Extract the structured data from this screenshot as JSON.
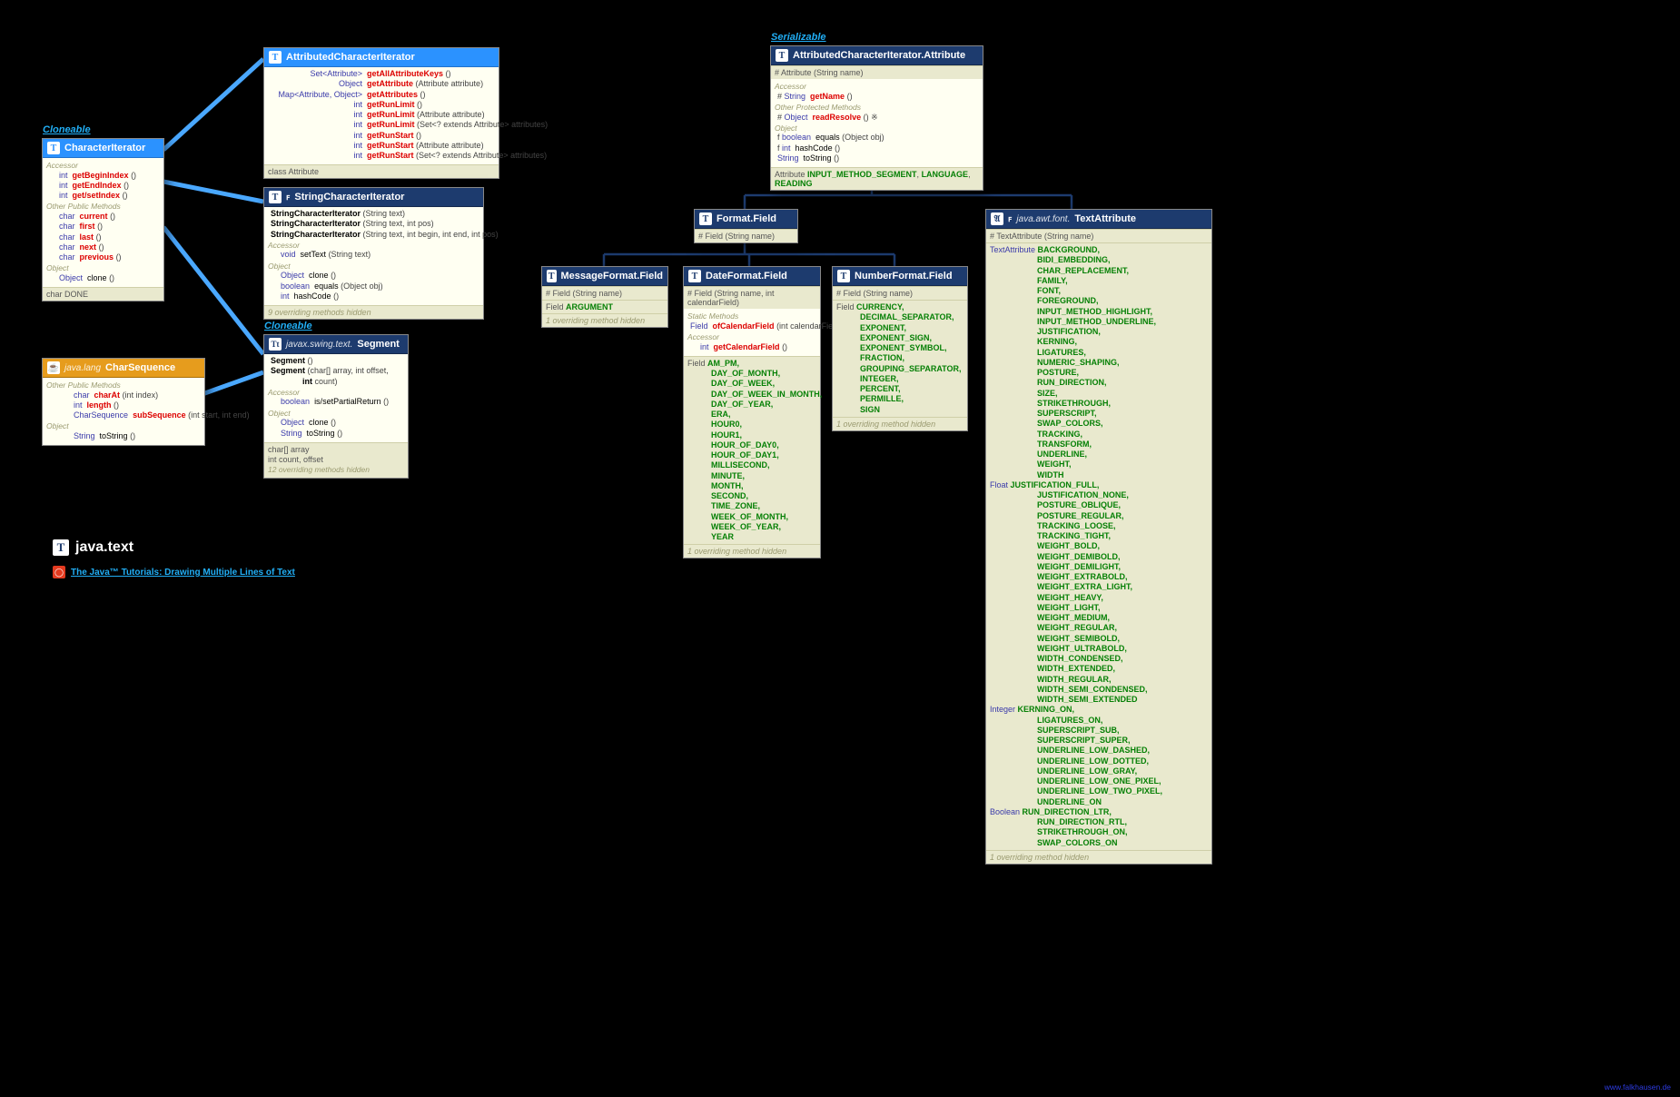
{
  "stereotypes": {
    "cloneable": "Cloneable",
    "serializable": "Serializable"
  },
  "package": {
    "name": "java.text",
    "tutorialLabel": "The Java™ Tutorials: Drawing Multiple Lines of Text",
    "siteLink": "www.falkhausen.de"
  },
  "boxes": {
    "characterIterator": {
      "title": "CharacterIterator",
      "sections": [
        {
          "heading": "Accessor",
          "rows": [
            {
              "ret": "int",
              "name": "getBeginIndex",
              "r": true,
              "sig": "()"
            },
            {
              "ret": "int",
              "name": "getEndIndex",
              "r": true,
              "sig": "()"
            },
            {
              "ret": "int",
              "name": "get/setIndex",
              "r": true,
              "sig": "()"
            }
          ]
        },
        {
          "heading": "Other Public Methods",
          "rows": [
            {
              "ret": "char",
              "name": "current",
              "r": true,
              "sig": "()"
            },
            {
              "ret": "char",
              "name": "first",
              "r": true,
              "sig": "()"
            },
            {
              "ret": "char",
              "name": "last",
              "r": true,
              "sig": "()"
            },
            {
              "ret": "char",
              "name": "next",
              "r": true,
              "sig": "()"
            },
            {
              "ret": "char",
              "name": "previous",
              "r": true,
              "sig": "()"
            }
          ]
        },
        {
          "heading": "Object",
          "rows": [
            {
              "ret": "Object",
              "name": "clone",
              "r": false,
              "sig": "()"
            }
          ]
        }
      ],
      "footer": "char DONE"
    },
    "charSequence": {
      "pkg": "java.lang",
      "title": "CharSequence",
      "sections": [
        {
          "heading": "Other Public Methods",
          "rows": [
            {
              "ret": "char",
              "name": "charAt",
              "r": true,
              "sig": "(int index)"
            },
            {
              "ret": "int",
              "name": "length",
              "r": true,
              "sig": "()"
            },
            {
              "retKw": "CharSequence",
              "name": "subSequence",
              "r": true,
              "sig": "(int start, int end)"
            }
          ]
        },
        {
          "heading": "Object",
          "rows": [
            {
              "ret": "String",
              "name": "toString",
              "r": false,
              "sig": "()"
            }
          ]
        }
      ]
    },
    "attrCharIter": {
      "title": "AttributedCharacterIterator",
      "rows": [
        {
          "ret": "Set<Attribute>",
          "name": "getAllAttributeKeys",
          "sig": "()"
        },
        {
          "ret": "Object",
          "name": "getAttribute",
          "sig": "(Attribute attribute)"
        },
        {
          "ret": "Map<Attribute, Object>",
          "name": "getAttributes",
          "sig": "()"
        },
        {
          "ret": "int",
          "name": "getRunLimit",
          "sig": "()"
        },
        {
          "ret": "int",
          "name": "getRunLimit",
          "sig": "(Attribute attribute)"
        },
        {
          "ret": "int",
          "name": "getRunLimit",
          "sig": "(Set<? extends Attribute> attributes)"
        },
        {
          "ret": "int",
          "name": "getRunStart",
          "sig": "()"
        },
        {
          "ret": "int",
          "name": "getRunStart",
          "sig": "(Attribute attribute)"
        },
        {
          "ret": "int",
          "name": "getRunStart",
          "sig": "(Set<? extends Attribute> attributes)"
        }
      ],
      "footer": "class Attribute"
    },
    "stringCharIter": {
      "title": "StringCharacterIterator",
      "ctors": [
        "StringCharacterIterator (String text)",
        "StringCharacterIterator (String text, int pos)",
        "StringCharacterIterator (String text, int begin, int end, int pos)"
      ],
      "sections": [
        {
          "heading": "Accessor",
          "rows": [
            {
              "ret": "void",
              "name": "setText",
              "sig": "(String text)"
            }
          ]
        },
        {
          "heading": "Object",
          "rows": [
            {
              "ret": "Object",
              "name": "clone",
              "sig": "()"
            },
            {
              "ret": "boolean",
              "name": "equals",
              "sig": "(Object obj)"
            },
            {
              "ret": "int",
              "name": "hashCode",
              "sig": "()"
            }
          ]
        }
      ],
      "hidden": "9 overriding methods hidden"
    },
    "segment": {
      "pkg": "javax.swing.text.",
      "title": "Segment",
      "ctors": [
        "Segment ()",
        "Segment (char[] array, int offset,",
        "              int count)"
      ],
      "sections": [
        {
          "heading": "Accessor",
          "rows": [
            {
              "ret": "boolean",
              "name": "is/setPartialReturn",
              "sig": "()"
            }
          ]
        },
        {
          "heading": "Object",
          "rows": [
            {
              "ret": "Object",
              "name": "clone",
              "sig": "()"
            },
            {
              "ret": "String",
              "name": "toString",
              "sig": "()"
            }
          ]
        }
      ],
      "footer1": "char[] array",
      "footer2": "int count, offset",
      "hidden": "12 overriding methods hidden"
    },
    "attrAttr": {
      "title": "AttributedCharacterIterator.Attribute",
      "ctor": "# Attribute (String name)",
      "sections": [
        {
          "heading": "Accessor",
          "rows": [
            {
              "vis": "#",
              "ret": "String",
              "name": "getName",
              "r": true,
              "sig": "()"
            }
          ]
        },
        {
          "heading": "Other Protected Methods",
          "rows": [
            {
              "vis": "#",
              "ret": "Object",
              "name": "readResolve",
              "r": true,
              "sig": "() ※"
            }
          ]
        },
        {
          "heading": "Object",
          "rows": [
            {
              "vis": "f",
              "ret": "boolean",
              "name": "equals",
              "sig": "(Object obj)"
            },
            {
              "vis": "f",
              "ret": "int",
              "name": "hashCode",
              "sig": "()"
            },
            {
              "vis": "",
              "ret": "String",
              "name": "toString",
              "sig": "()"
            }
          ]
        }
      ],
      "footer": "Attribute INPUT_METHOD_SEGMENT, LANGUAGE, READING"
    },
    "formatField": {
      "title": "Format.Field",
      "ctor": "# Field (String name)"
    },
    "messageFormatField": {
      "title": "MessageFormat.Field",
      "ctor": "# Field (String name)",
      "footer": "Field ARGUMENT",
      "hidden": "1 overriding method hidden"
    },
    "dateFormatField": {
      "title": "DateFormat.Field",
      "ctor": "# Field (String name, int calendarField)",
      "staticHeading": "Static Methods",
      "staticRow": {
        "ret": "Field",
        "name": "ofCalendarField",
        "sig": "(int calendarField)"
      },
      "accHeading": "Accessor",
      "accRow": {
        "ret": "int",
        "name": "getCalendarField",
        "sig": "()"
      },
      "constLabel": "Field",
      "consts": [
        "AM_PM,",
        "DAY_OF_MONTH,",
        "DAY_OF_WEEK,",
        "DAY_OF_WEEK_IN_MONTH,",
        "DAY_OF_YEAR,",
        "ERA,",
        "HOUR0,",
        "HOUR1,",
        "HOUR_OF_DAY0,",
        "HOUR_OF_DAY1,",
        "MILLISECOND,",
        "MINUTE,",
        "MONTH,",
        "SECOND,",
        "TIME_ZONE,",
        "WEEK_OF_MONTH,",
        "WEEK_OF_YEAR,",
        "YEAR"
      ],
      "hidden": "1 overriding method hidden"
    },
    "numberFormatField": {
      "title": "NumberFormat.Field",
      "ctor": "# Field (String name)",
      "constLabel": "Field",
      "consts": [
        "CURRENCY,",
        "DECIMAL_SEPARATOR,",
        "EXPONENT,",
        "EXPONENT_SIGN,",
        "EXPONENT_SYMBOL,",
        "FRACTION,",
        "GROUPING_SEPARATOR,",
        "INTEGER,",
        "PERCENT,",
        "PERMILLE,",
        "SIGN"
      ],
      "hidden": "1 overriding method hidden"
    },
    "textAttribute": {
      "pkg": "java.awt.font.",
      "title": "TextAttribute",
      "ctor": "# TextAttribute (String name)",
      "groups": [
        {
          "label": "TextAttribute",
          "items": [
            "BACKGROUND,",
            "BIDI_EMBEDDING,",
            "CHAR_REPLACEMENT,",
            "FAMILY,",
            "FONT,",
            "FOREGROUND,",
            "INPUT_METHOD_HIGHLIGHT,",
            "INPUT_METHOD_UNDERLINE,",
            "JUSTIFICATION,",
            "KERNING,",
            "LIGATURES,",
            "NUMERIC_SHAPING,",
            "POSTURE,",
            "RUN_DIRECTION,",
            "SIZE,",
            "STRIKETHROUGH,",
            "SUPERSCRIPT,",
            "SWAP_COLORS,",
            "TRACKING,",
            "TRANSFORM,",
            "UNDERLINE,",
            "WEIGHT,",
            "WIDTH"
          ]
        },
        {
          "label": "Float",
          "items": [
            "JUSTIFICATION_FULL,",
            "JUSTIFICATION_NONE,",
            "POSTURE_OBLIQUE,",
            "POSTURE_REGULAR,",
            "TRACKING_LOOSE,",
            "TRACKING_TIGHT,",
            "WEIGHT_BOLD,",
            "WEIGHT_DEMIBOLD,",
            "WEIGHT_DEMILIGHT,",
            "WEIGHT_EXTRABOLD,",
            "WEIGHT_EXTRA_LIGHT,",
            "WEIGHT_HEAVY,",
            "WEIGHT_LIGHT,",
            "WEIGHT_MEDIUM,",
            "WEIGHT_REGULAR,",
            "WEIGHT_SEMIBOLD,",
            "WEIGHT_ULTRABOLD,",
            "WIDTH_CONDENSED,",
            "WIDTH_EXTENDED,",
            "WIDTH_REGULAR,",
            "WIDTH_SEMI_CONDENSED,",
            "WIDTH_SEMI_EXTENDED"
          ]
        },
        {
          "label": "Integer",
          "items": [
            "KERNING_ON,",
            "LIGATURES_ON,",
            "SUPERSCRIPT_SUB,",
            "SUPERSCRIPT_SUPER,",
            "UNDERLINE_LOW_DASHED,",
            "UNDERLINE_LOW_DOTTED,",
            "UNDERLINE_LOW_GRAY,",
            "UNDERLINE_LOW_ONE_PIXEL,",
            "UNDERLINE_LOW_TWO_PIXEL,",
            "UNDERLINE_ON"
          ]
        },
        {
          "label": "Boolean",
          "items": [
            "RUN_DIRECTION_LTR,",
            "RUN_DIRECTION_RTL,",
            "STRIKETHROUGH_ON,",
            "SWAP_COLORS_ON"
          ]
        }
      ],
      "hidden": "1 overriding method hidden"
    }
  }
}
